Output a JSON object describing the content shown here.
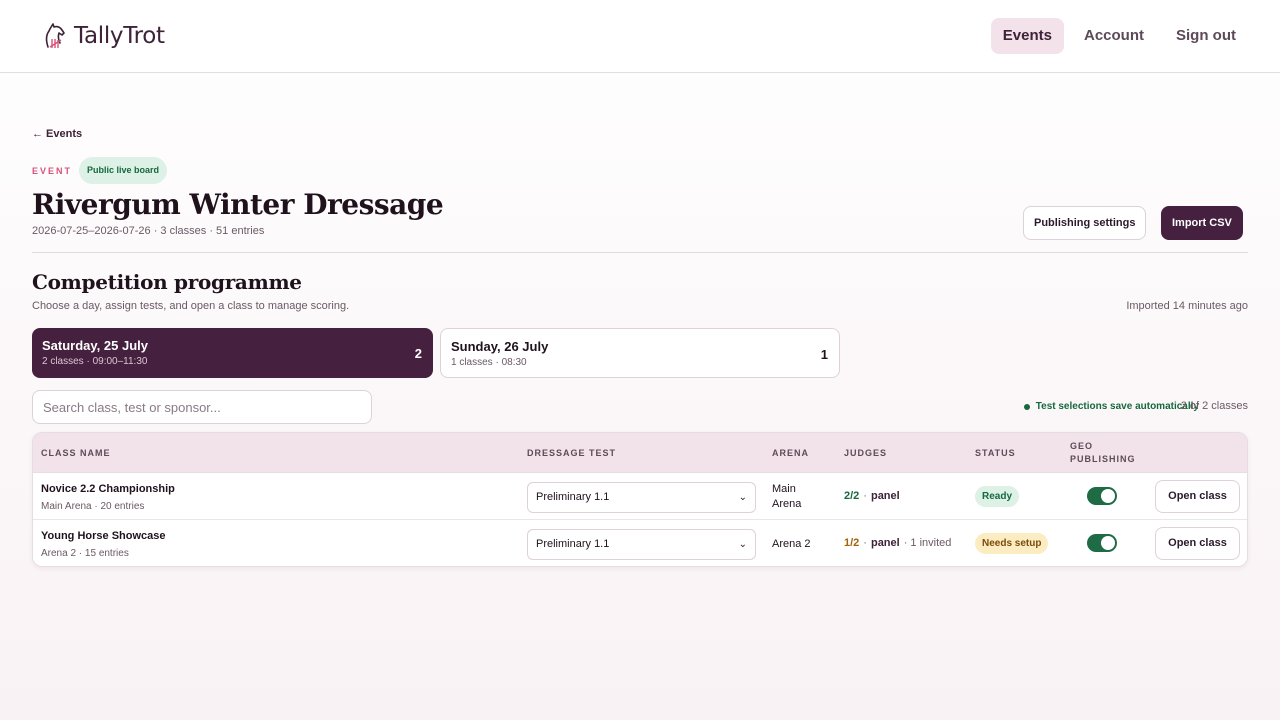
{
  "header": {
    "brand": "TallyTrot",
    "brand_icon": "horse-tally-icon",
    "nav": [
      {
        "label": "Events",
        "active": true
      },
      {
        "label": "Account",
        "active": false
      },
      {
        "label": "Sign out",
        "active": false
      }
    ]
  },
  "event": {
    "back_label": "← Events",
    "eyebrow": "EVENT",
    "live_badge": "Public live board",
    "title": "Rivergum Winter Dressage",
    "meta": "2026-07-25–2026-07-26 · 3 classes · 51 entries",
    "publishing_button": "Publishing settings",
    "import_button": "Import CSV"
  },
  "programme": {
    "title": "Competition programme",
    "subtitle": "Choose a day, assign tests, and open a class to manage scoring.",
    "imported": "Imported 14 minutes ago",
    "days": [
      {
        "title": "Saturday, 25 July",
        "sub": "2 classes · 09:00–11:30",
        "count": "2",
        "active": true
      },
      {
        "title": "Sunday, 26 July",
        "sub": "1 classes · 08:30",
        "count": "1",
        "active": false
      }
    ],
    "search_placeholder": "Search class, test or sponsor...",
    "autosave": "Test selections save automatically",
    "count_text": "2 of 2 classes"
  },
  "table": {
    "headers": {
      "class_name": "CLASS NAME",
      "dressage_test": "DRESSAGE TEST",
      "arena": "ARENA",
      "judges": "JUDGES",
      "status": "STATUS",
      "geo_1": "GEO",
      "geo_2": "PUBLISHING"
    },
    "rows": [
      {
        "name": "Novice 2.2 Championship",
        "meta": "Main Arena · 20 entries",
        "test": "Preliminary 1.1",
        "arena_1": "Main",
        "arena_2": "Arena",
        "judges_ratio": "2/2",
        "judges_sep": "·",
        "judges_panel": "panel",
        "judges_extra": "",
        "status": "Ready",
        "geo_on": true,
        "action": "Open class"
      },
      {
        "name": "Young Horse Showcase",
        "meta": "Arena 2 · 15 entries",
        "test": "Preliminary 1.1",
        "arena_1": "Arena 2",
        "arena_2": "",
        "judges_ratio": "1/2",
        "judges_sep": "·",
        "judges_panel": "panel",
        "judges_extra": "· 1 invited",
        "status": "Needs setup",
        "geo_on": true,
        "action": "Open class"
      }
    ]
  },
  "colors": {
    "brand": "#45213f",
    "success": "#16683d",
    "warning": "#a5620c",
    "accent": "#d8527b"
  }
}
